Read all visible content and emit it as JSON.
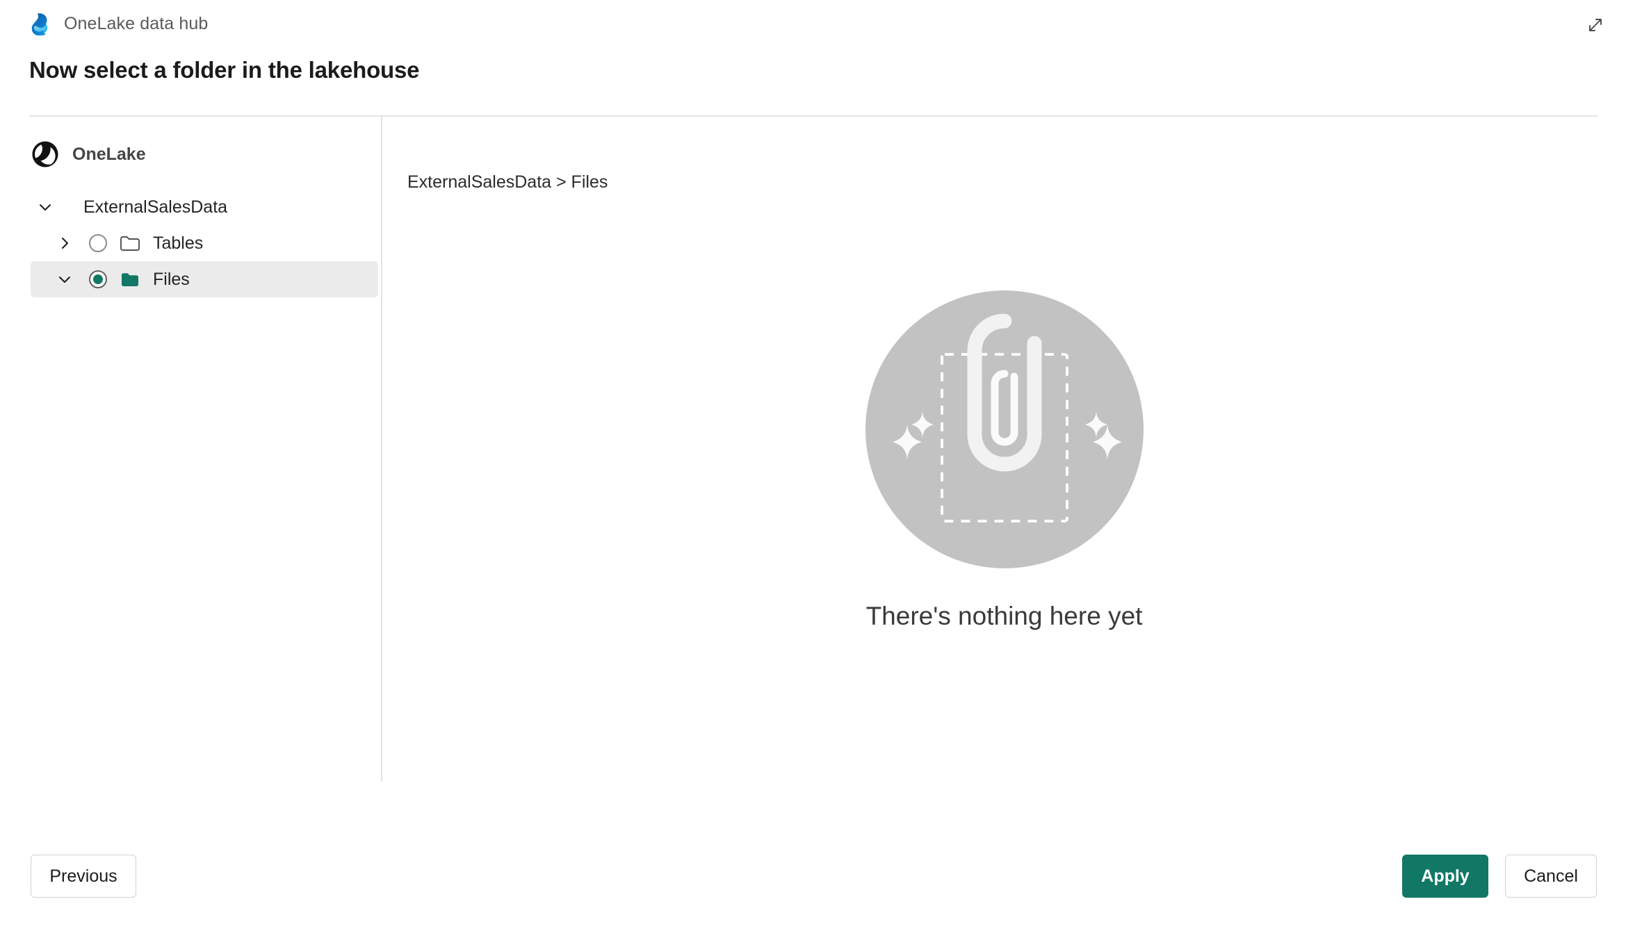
{
  "header": {
    "app_title": "OneLake data hub",
    "logo_icon": "onelake-droplet-icon",
    "expand_icon": "expand-diagonal-arrows-icon"
  },
  "page": {
    "title": "Now select a folder in the lakehouse"
  },
  "sidebar": {
    "root": {
      "label": "OneLake",
      "icon": "onelake-circle-icon"
    },
    "tree": [
      {
        "label": "ExternalSalesData",
        "level": 1,
        "twisty": "chevron-down-icon",
        "expanded": true,
        "has_radio": false,
        "has_folder": false,
        "selected": false
      },
      {
        "label": "Tables",
        "level": 2,
        "twisty": "chevron-right-icon",
        "expanded": false,
        "has_radio": true,
        "checked": false,
        "has_folder": true,
        "folder_icon": "folder-outline-icon",
        "selected": false
      },
      {
        "label": "Files",
        "level": 2,
        "twisty": "chevron-down-icon",
        "expanded": true,
        "has_radio": true,
        "checked": true,
        "has_folder": true,
        "folder_icon": "folder-filled-icon",
        "selected": true
      }
    ]
  },
  "content": {
    "breadcrumb": "ExternalSalesData > Files",
    "empty_state": {
      "message": "There's nothing here yet",
      "illustration": "paperclip-empty-folder-illustration"
    }
  },
  "footer": {
    "previous_label": "Previous",
    "apply_label": "Apply",
    "cancel_label": "Cancel"
  },
  "colors": {
    "accent_teal": "#117865",
    "selected_row_bg": "#ebebeb",
    "divider": "#e3e3e3",
    "illustration_circle": "#c2c2c2",
    "text_primary": "#242424",
    "text_muted": "#5a5a5a"
  }
}
